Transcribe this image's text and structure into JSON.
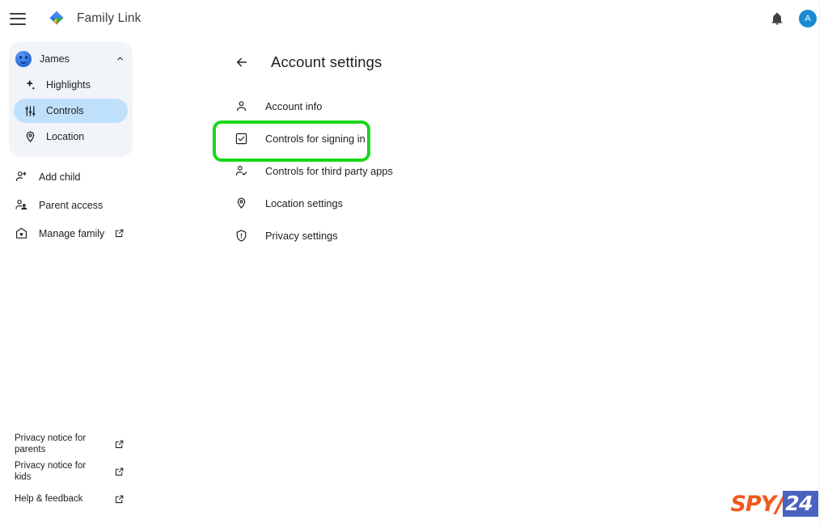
{
  "topbar": {
    "menu_icon": "hamburger-menu-icon",
    "brand_icon": "family-link-logo-icon",
    "title": "Family Link",
    "notifications_icon": "bell-icon",
    "account_initial": "A",
    "account_color": "#1a8ad4"
  },
  "sidebar": {
    "child": {
      "name": "James",
      "avatar_icon": "child-avatar",
      "expand_icon": "chevron-up-icon",
      "items": [
        {
          "label": "Highlights",
          "icon": "sparkle-icon",
          "active": false
        },
        {
          "label": "Controls",
          "icon": "tune-sliders-icon",
          "active": true
        },
        {
          "label": "Location",
          "icon": "location-pin-icon",
          "active": false
        }
      ]
    },
    "actions": [
      {
        "label": "Add child",
        "icon": "person-add-icon",
        "external": false
      },
      {
        "label": "Parent access",
        "icon": "people-icon",
        "external": false
      },
      {
        "label": "Manage family",
        "icon": "family-home-icon",
        "external": true
      }
    ],
    "footer": [
      {
        "label": "Privacy notice for parents",
        "external": true
      },
      {
        "label": "Privacy notice for kids",
        "external": true
      },
      {
        "label": "Help & feedback",
        "external": true
      }
    ],
    "external_icon": "open-in-new-icon",
    "active_pill_color": "#bfe0fb",
    "card_color": "#f1f4f9"
  },
  "main": {
    "back_icon": "arrow-back-icon",
    "title": "Account settings",
    "settings": [
      {
        "label": "Account info",
        "icon": "person-icon",
        "highlighted": false
      },
      {
        "label": "Controls for signing in",
        "icon": "checkbox-icon",
        "highlighted": true
      },
      {
        "label": "Controls for third party apps",
        "icon": "person-check-icon",
        "highlighted": false
      },
      {
        "label": "Location settings",
        "icon": "location-pin-icon",
        "highlighted": false
      },
      {
        "label": "Privacy settings",
        "icon": "shield-icon",
        "highlighted": false
      }
    ],
    "highlight_color": "#17d817"
  },
  "watermark": {
    "brand": "SPY",
    "slash": "/",
    "number": "24",
    "brand_color": "#f2591f",
    "number_bg": "#4a63bf"
  }
}
